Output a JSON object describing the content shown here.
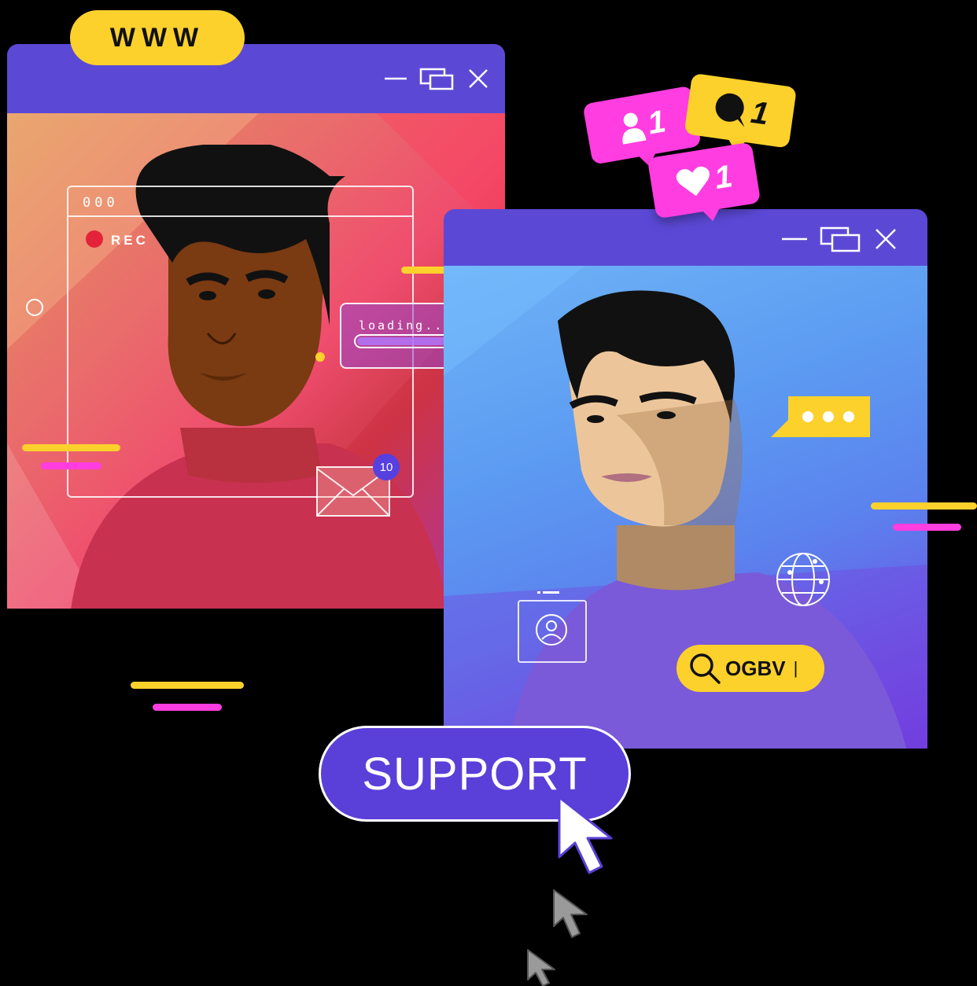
{
  "address_pill": {
    "label": "WWW"
  },
  "window_left": {
    "controls": [
      "minimize-icon",
      "restore-icon",
      "close-icon"
    ],
    "recorder": {
      "dots": "000",
      "rec_label": "REC"
    },
    "loading": {
      "label": "loading...",
      "progress": 0.75
    },
    "mail_badge": "10"
  },
  "notifications": [
    {
      "icon": "user-icon",
      "count": "1",
      "color": "#ff3de0"
    },
    {
      "icon": "comment-icon",
      "count": "1",
      "color": "#fdd12c"
    },
    {
      "icon": "heart-icon",
      "count": "1",
      "color": "#ff3de0"
    }
  ],
  "window_right": {
    "controls": [
      "minimize-icon",
      "restore-icon",
      "close-icon"
    ],
    "search": {
      "query": "OGBV",
      "caret": "|"
    }
  },
  "cta": {
    "label": "SUPPORT"
  },
  "colors": {
    "accent": "#5b49d6",
    "yellow": "#fdd12c",
    "pink": "#ff3de0"
  }
}
